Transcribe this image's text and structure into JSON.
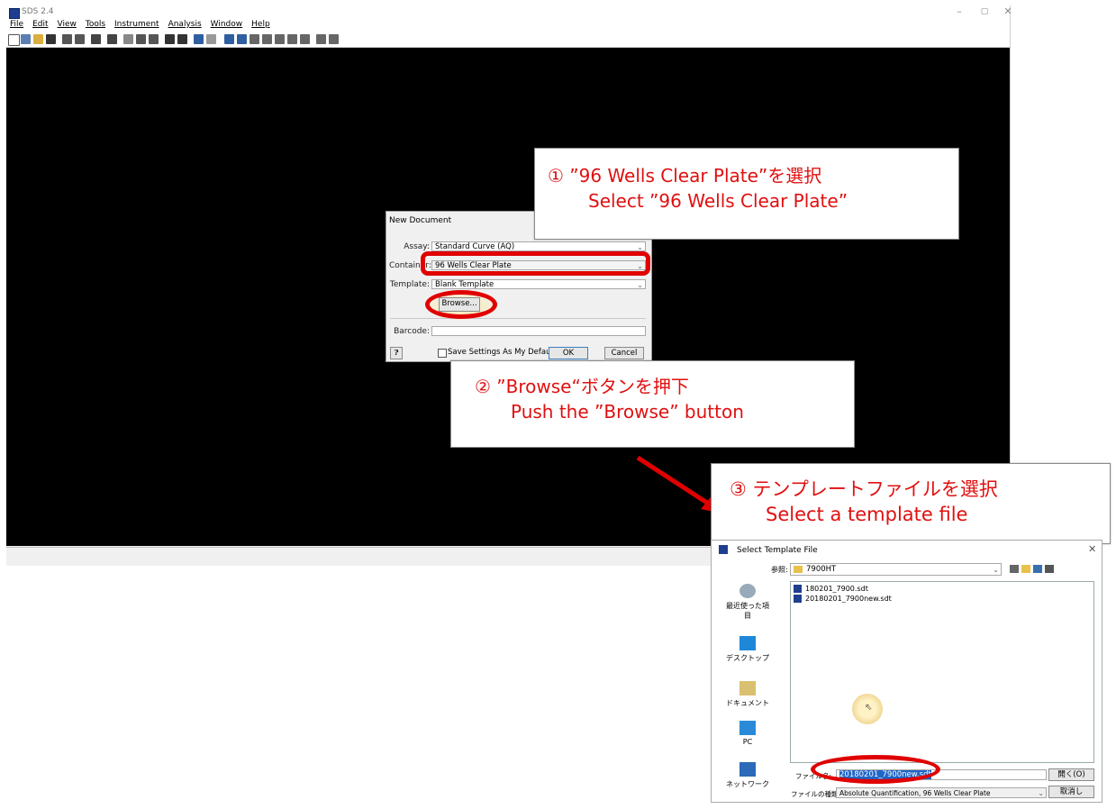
{
  "window": {
    "title": "SDS 2.4",
    "controls": [
      "–",
      "▢",
      "✕"
    ]
  },
  "menu": [
    "File",
    "Edit",
    "View",
    "Tools",
    "Instrument",
    "Analysis",
    "Window",
    "Help"
  ],
  "new_document": {
    "title": "New Document",
    "assay_label": "Assay:",
    "assay_value": "Standard Curve (AQ)",
    "container_label": "Container:",
    "container_value": "96 Wells Clear Plate",
    "template_label": "Template:",
    "template_value": "Blank Template",
    "browse_label": "Browse...",
    "barcode_label": "Barcode:",
    "barcode_value": "",
    "help_label": "?",
    "save_default_label": "Save Settings As My Default",
    "ok_label": "OK",
    "cancel_label": "Cancel"
  },
  "callouts": {
    "step1_jp": "① ”96 Wells Clear Plate”を選択",
    "step1_en": "Select ”96 Wells Clear Plate”",
    "step2_jp": "② ”Browse“ボタンを押下",
    "step2_en": "Push the ”Browse” button",
    "step3_jp": "③ テンプレートファイルを選択",
    "step3_en": "Select a template file"
  },
  "select_template": {
    "title": "Select Template File",
    "lookin_label": "参照:",
    "lookin_value": "7900HT",
    "files": [
      "180201_7900.sdt",
      "20180201_7900new.sdt"
    ],
    "places": [
      "最近使った項目",
      "デスクトップ",
      "ドキュメント",
      "PC",
      "ネットワーク"
    ],
    "filename_label": "ファイル名:",
    "filename_value": "20180201_7900new.sdt",
    "filetype_label": "ファイルの種類:",
    "filetype_value": "Absolute Quantification, 96 Wells Clear Plate",
    "open_label": "開く(O)",
    "cancel_label": "取消し"
  },
  "colors": {
    "accent": "#e00000",
    "client_bg": "#000000"
  }
}
